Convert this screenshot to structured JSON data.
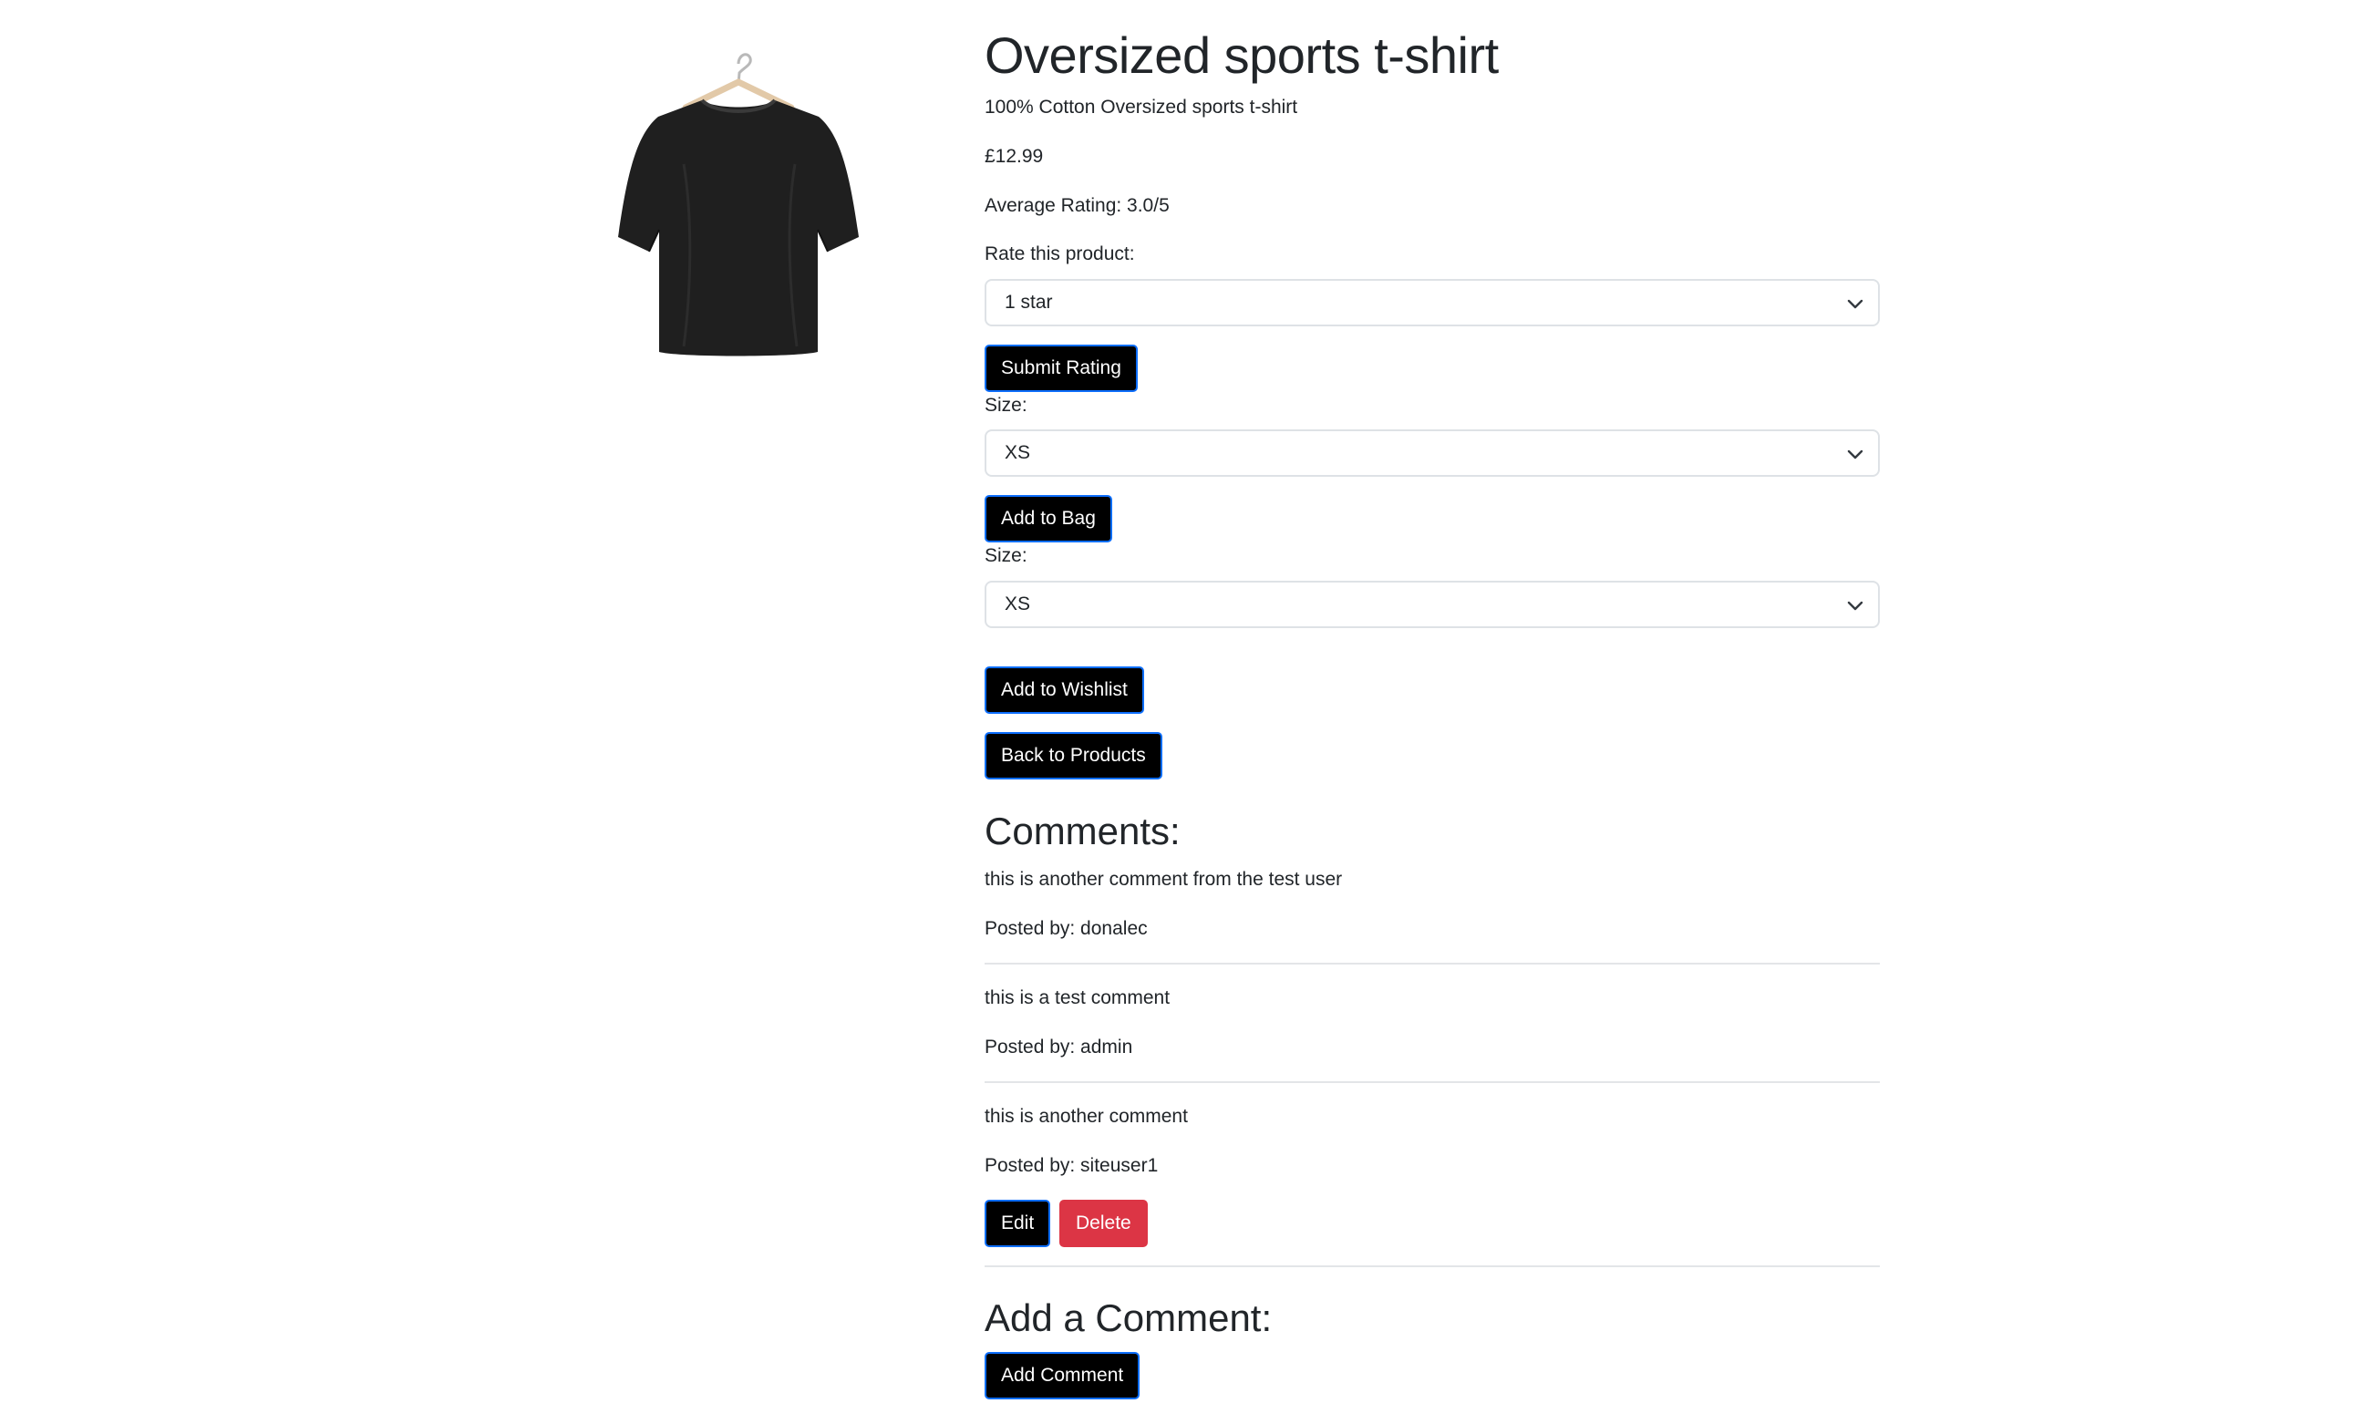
{
  "product": {
    "title": "Oversized sports t-shirt",
    "description": "100% Cotton Oversized sports t-shirt",
    "price": "£12.99",
    "average_rating": "Average Rating: 3.0/5"
  },
  "rating": {
    "label": "Rate this product:",
    "selected": "1 star",
    "submit_label": "Submit Rating"
  },
  "bag": {
    "size_label": "Size:",
    "size_selected": "XS",
    "add_label": "Add to Bag"
  },
  "wishlist": {
    "size_label": "Size:",
    "size_selected": "XS",
    "add_label": "Add to Wishlist"
  },
  "back_label": "Back to Products",
  "comments": {
    "heading": "Comments:",
    "items": [
      {
        "text": "this is another comment from the test user",
        "posted_by": "Posted by: donalec"
      },
      {
        "text": "this is a test comment",
        "posted_by": "Posted by: admin"
      },
      {
        "text": "this is another comment",
        "posted_by": "Posted by: siteuser1"
      }
    ],
    "edit_label": "Edit",
    "delete_label": "Delete"
  },
  "add_comment": {
    "heading": "Add a Comment:",
    "button_label": "Add Comment"
  },
  "colors": {
    "button_bg": "#000000",
    "button_border": "#0d6efd",
    "danger": "#dc3545",
    "text": "#212529",
    "divider": "#e3e5e8"
  },
  "icons": {
    "product_image": "black-tshirt-on-hanger",
    "select_arrow": "chevron-down-icon"
  }
}
